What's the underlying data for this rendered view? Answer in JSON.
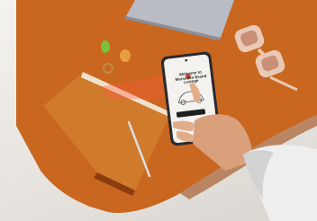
{
  "scene": {
    "description_free": true,
    "phone_screen": {
      "title_line_1": "Welcome to",
      "title_line_2": "Mercedes Brand Lounge"
    },
    "colors": {
      "desk_orange": "#c9661f",
      "notebook": "#d07a2c",
      "sunglasses": "#e9c9b5",
      "wall": "#ece9e4",
      "phone_body": "#2a2a2e",
      "screen": "#f4f2ef"
    }
  }
}
